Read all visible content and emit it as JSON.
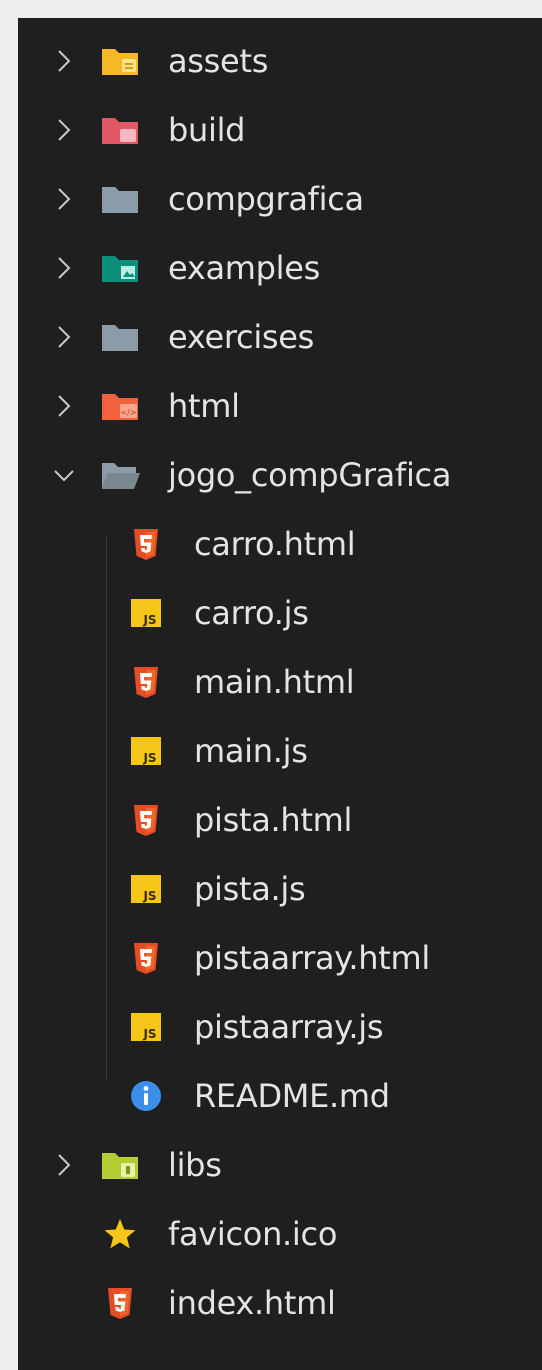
{
  "explorer": {
    "items": [
      {
        "label": "assets",
        "kind": "folder",
        "expanded": false,
        "icon": "folder-assets-icon",
        "color": "#f6b825"
      },
      {
        "label": "build",
        "kind": "folder",
        "expanded": false,
        "icon": "folder-build-icon",
        "color": "#e25865"
      },
      {
        "label": "compgrafica",
        "kind": "folder",
        "expanded": false,
        "icon": "folder-icon",
        "color": "#8b9ba7"
      },
      {
        "label": "examples",
        "kind": "folder",
        "expanded": false,
        "icon": "folder-examples-icon",
        "color": "#0e8f7e"
      },
      {
        "label": "exercises",
        "kind": "folder",
        "expanded": false,
        "icon": "folder-icon",
        "color": "#8b9ba7"
      },
      {
        "label": "html",
        "kind": "folder",
        "expanded": false,
        "icon": "folder-html-icon",
        "color": "#f2633d"
      },
      {
        "label": "jogo_compGrafica",
        "kind": "folder",
        "expanded": true,
        "icon": "folder-open-icon",
        "color": "#8b9ba7"
      },
      {
        "label": "carro.html",
        "kind": "file",
        "icon": "html5-icon",
        "color": "#e44d26"
      },
      {
        "label": "carro.js",
        "kind": "file",
        "icon": "javascript-icon",
        "color": "#f5c518"
      },
      {
        "label": "main.html",
        "kind": "file",
        "icon": "html5-icon",
        "color": "#e44d26"
      },
      {
        "label": "main.js",
        "kind": "file",
        "icon": "javascript-icon",
        "color": "#f5c518"
      },
      {
        "label": "pista.html",
        "kind": "file",
        "icon": "html5-icon",
        "color": "#e44d26"
      },
      {
        "label": "pista.js",
        "kind": "file",
        "icon": "javascript-icon",
        "color": "#f5c518"
      },
      {
        "label": "pistaarray.html",
        "kind": "file",
        "icon": "html5-icon",
        "color": "#e44d26"
      },
      {
        "label": "pistaarray.js",
        "kind": "file",
        "icon": "javascript-icon",
        "color": "#f5c518"
      },
      {
        "label": "README.md",
        "kind": "file",
        "icon": "info-icon",
        "color": "#3b8eea"
      },
      {
        "label": "libs",
        "kind": "folder",
        "expanded": false,
        "icon": "folder-libs-icon",
        "color": "#b5cc35"
      },
      {
        "label": "favicon.ico",
        "kind": "file",
        "icon": "star-icon",
        "color": "#f5c518"
      },
      {
        "label": "index.html",
        "kind": "file",
        "icon": "html5-icon",
        "color": "#e44d26"
      }
    ]
  }
}
